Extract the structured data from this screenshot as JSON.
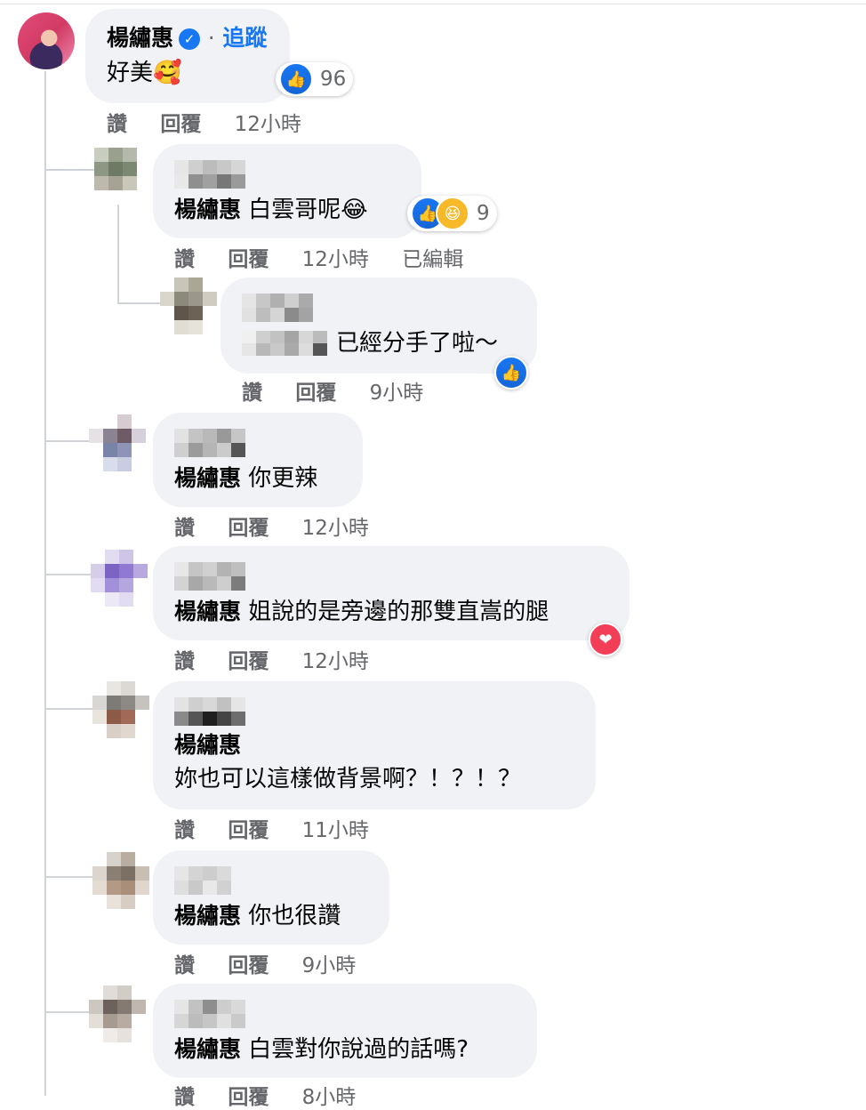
{
  "main_comment": {
    "author": "楊繡惠",
    "separator": "·",
    "follow_label": "追蹤",
    "text": "好美🥰",
    "reaction_count": "96",
    "actions": {
      "like": "讚",
      "reply": "回覆",
      "time": "12小時"
    }
  },
  "replies": [
    {
      "tag": "楊繡惠",
      "text": "白雲哥呢😂",
      "reaction_count": "9",
      "like": "讚",
      "reply": "回覆",
      "time": "12小時",
      "edited": "已編輯"
    },
    {
      "text": "已經分手了啦～",
      "like": "讚",
      "reply": "回覆",
      "time": "9小時"
    },
    {
      "tag": "楊繡惠",
      "text": "你更辣",
      "like": "讚",
      "reply": "回覆",
      "time": "12小時"
    },
    {
      "tag": "楊繡惠",
      "text": "姐說的是旁邊的那雙直嵩的腿",
      "like": "讚",
      "reply": "回覆",
      "time": "12小時"
    },
    {
      "tag": "楊繡惠",
      "text": "妳也可以這樣做背景啊？！？！？",
      "like": "讚",
      "reply": "回覆",
      "time": "11小時"
    },
    {
      "tag": "楊繡惠",
      "text": "你也很讚",
      "like": "讚",
      "reply": "回覆",
      "time": "9小時"
    },
    {
      "tag": "楊繡惠",
      "text": "白雲對你說過的話嗎?",
      "like": "讚",
      "reply": "回覆",
      "time": "8小時"
    }
  ],
  "icons": {
    "verified": "verified-badge-icon",
    "like": "thumbs-up-icon",
    "haha": "laughing-face-icon",
    "love": "heart-icon"
  },
  "colors": {
    "bubble": "#f0f2f5",
    "link": "#1877f2",
    "muted": "#65676b",
    "love": "#f33e58"
  }
}
